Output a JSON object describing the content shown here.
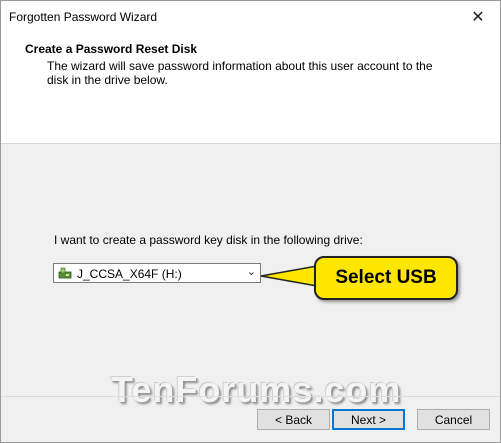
{
  "window": {
    "title": "Forgotten Password Wizard",
    "close_glyph": "✕"
  },
  "header": {
    "title": "Create a Password Reset Disk",
    "description": "The wizard will save password information about this user account to the disk in the drive below."
  },
  "main": {
    "prompt": "I want to create a password key disk in the following drive:",
    "drive_select": {
      "value": "J_CCSA_X64F (H:)",
      "icon": "usb-drive-icon"
    }
  },
  "callout": {
    "text": "Select USB",
    "color": "#ffe600"
  },
  "watermark": "TenForums.com",
  "buttons": {
    "back": "< Back",
    "next": "Next >",
    "cancel": "Cancel"
  },
  "colors": {
    "accent": "#0078d7"
  }
}
